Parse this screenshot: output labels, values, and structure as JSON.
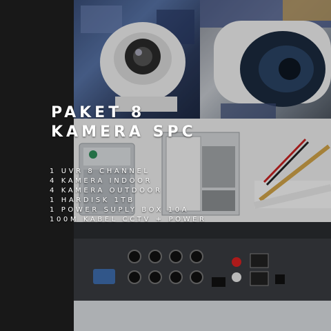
{
  "heading": {
    "line1": "PAKET 8",
    "line2": "KAMERA SPC"
  },
  "items": [
    "1 UVR 8 CHANNEL",
    "4 KAMERA INDOOR",
    "4 KAMERA OUTDOOR",
    "1 HARDISK 1TB",
    "1 POWER SUPLY BOX 10A",
    "100M KABEL CCTV + POWER"
  ],
  "colors": {
    "left_bar": "#1f1f1f",
    "text": "#ffffff"
  }
}
